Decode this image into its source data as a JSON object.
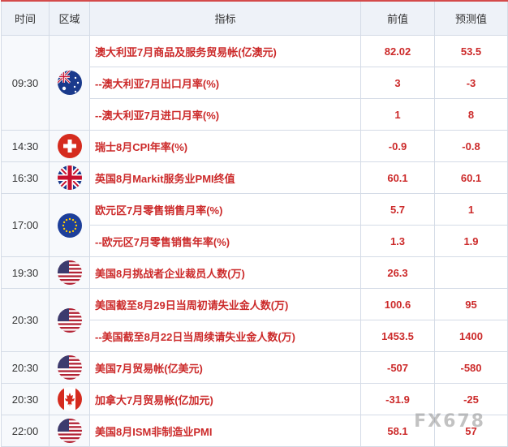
{
  "header": {
    "time": "时间",
    "region": "区域",
    "indicator": "指标",
    "prev": "前值",
    "forecast": "预测值"
  },
  "rows": [
    {
      "time": "09:30",
      "flag": "australia-flag-icon",
      "items": [
        {
          "name": "澳大利亚7月商品及服务贸易帐(亿澳元)",
          "prev": "82.02",
          "forecast": "53.5"
        },
        {
          "name": "--澳大利亚7月出口月率(%)",
          "prev": "3",
          "forecast": "-3"
        },
        {
          "name": "--澳大利亚7月进口月率(%)",
          "prev": "1",
          "forecast": "8"
        }
      ]
    },
    {
      "time": "14:30",
      "flag": "switzerland-flag-icon",
      "items": [
        {
          "name": "瑞士8月CPI年率(%)",
          "prev": "-0.9",
          "forecast": "-0.8"
        }
      ]
    },
    {
      "time": "16:30",
      "flag": "uk-flag-icon",
      "items": [
        {
          "name": "英国8月Markit服务业PMI终值",
          "prev": "60.1",
          "forecast": "60.1"
        }
      ]
    },
    {
      "time": "17:00",
      "flag": "eu-flag-icon",
      "items": [
        {
          "name": "欧元区7月零售销售月率(%)",
          "prev": "5.7",
          "forecast": "1"
        },
        {
          "name": "--欧元区7月零售销售年率(%)",
          "prev": "1.3",
          "forecast": "1.9"
        }
      ]
    },
    {
      "time": "19:30",
      "flag": "us-flag-icon",
      "items": [
        {
          "name": "美国8月挑战者企业裁员人数(万)",
          "prev": "26.3",
          "forecast": ""
        }
      ]
    },
    {
      "time": "20:30",
      "flag": "us-flag-icon",
      "items": [
        {
          "name": "美国截至8月29日当周初请失业金人数(万)",
          "prev": "100.6",
          "forecast": "95"
        },
        {
          "name": "--美国截至8月22日当周续请失业金人数(万)",
          "prev": "1453.5",
          "forecast": "1400"
        }
      ]
    },
    {
      "time": "20:30",
      "flag": "us-flag-icon",
      "items": [
        {
          "name": "美国7月贸易帐(亿美元)",
          "prev": "-507",
          "forecast": "-580"
        }
      ]
    },
    {
      "time": "20:30",
      "flag": "canada-flag-icon",
      "items": [
        {
          "name": "加拿大7月贸易帐(亿加元)",
          "prev": "-31.9",
          "forecast": "-25"
        }
      ]
    },
    {
      "time": "22:00",
      "flag": "us-flag-icon",
      "items": [
        {
          "name": "美国8月ISM非制造业PMI",
          "prev": "58.1",
          "forecast": "57"
        }
      ]
    }
  ],
  "watermark": "FX678"
}
